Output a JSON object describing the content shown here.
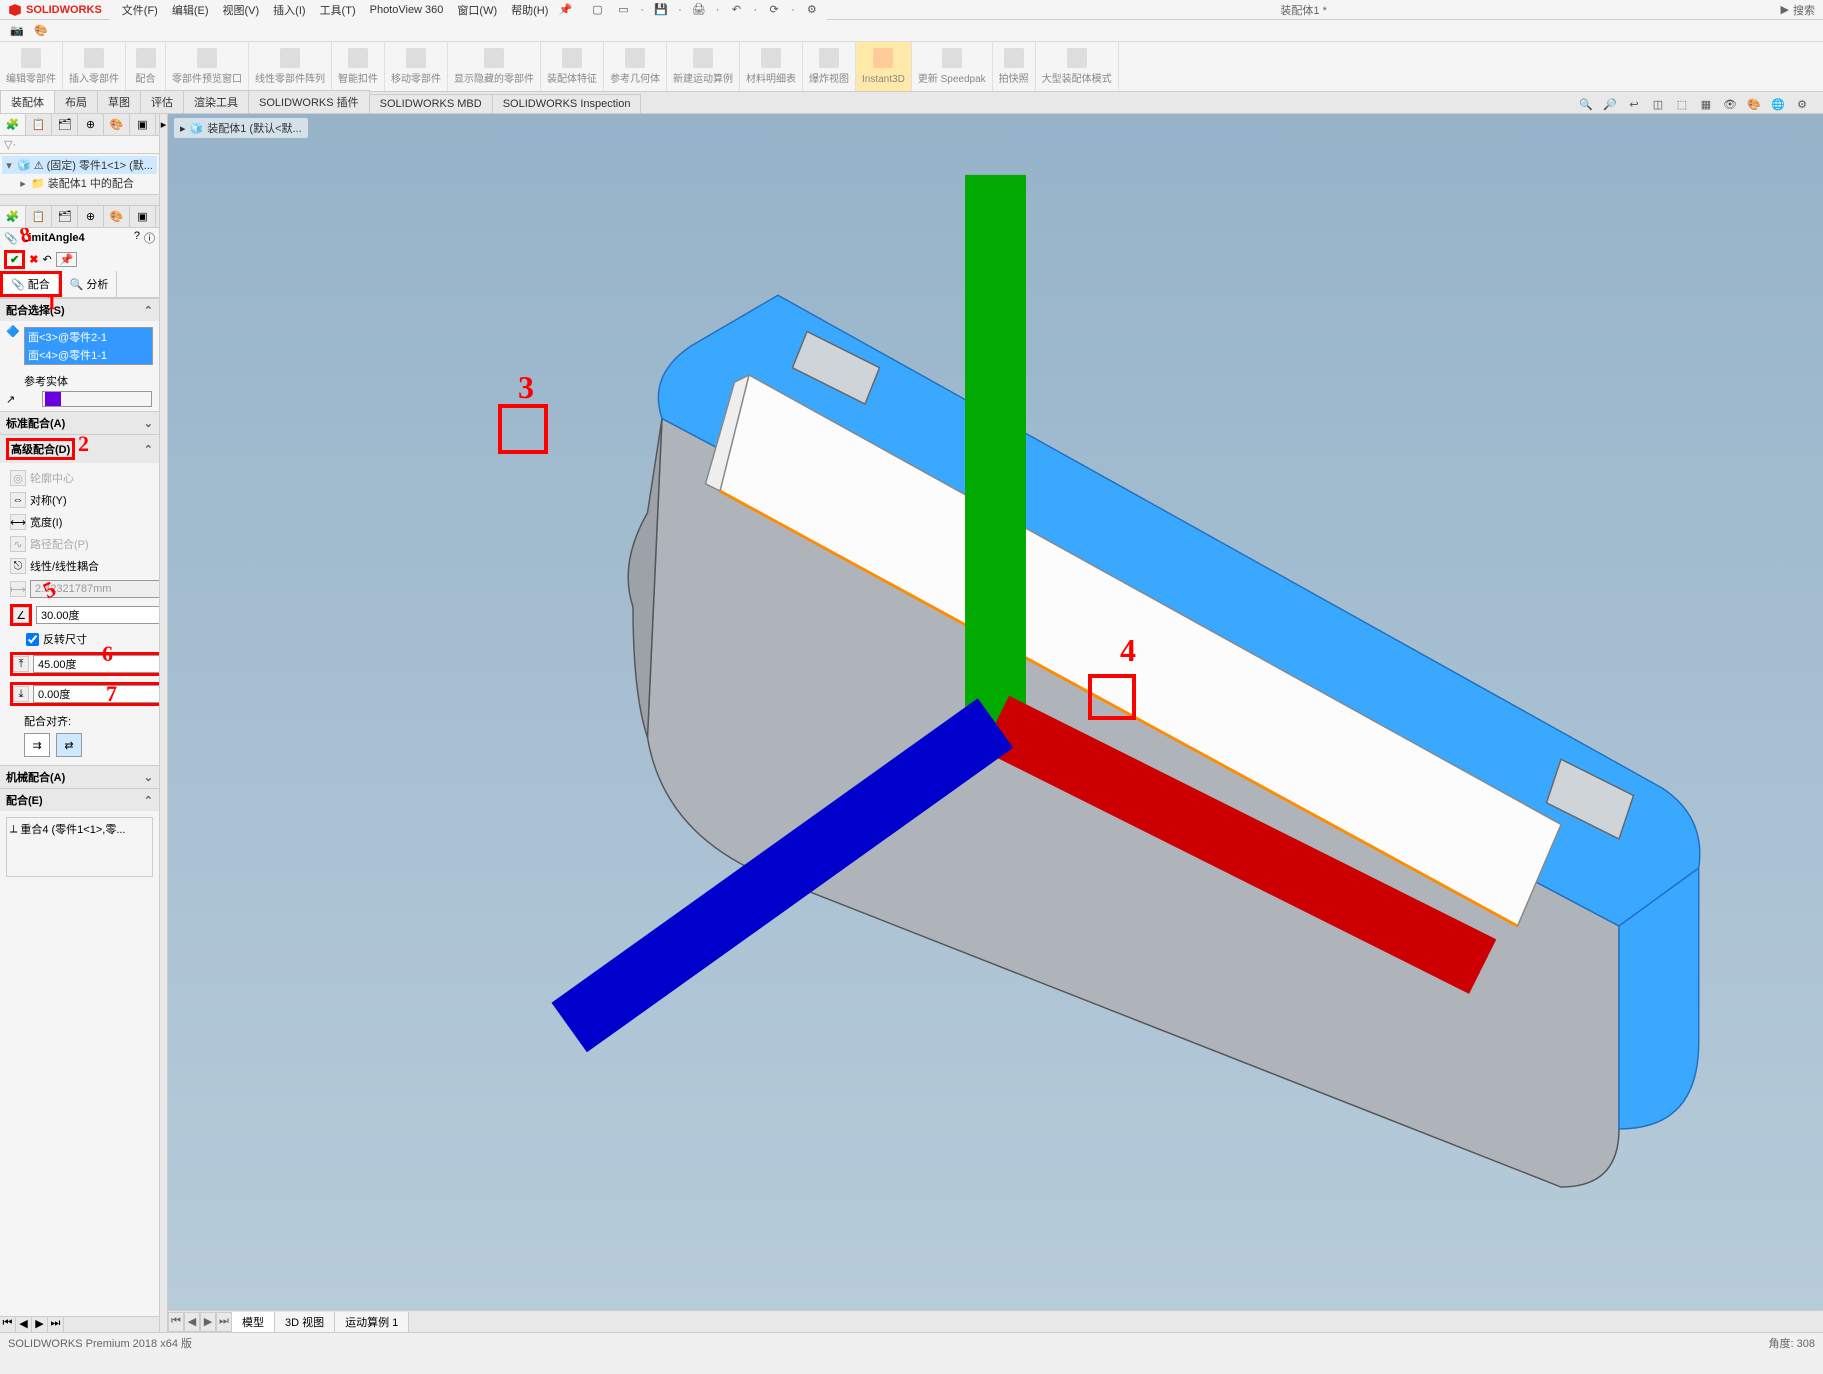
{
  "app": {
    "logo_text": "SOLIDWORKS",
    "doc_title": "装配体1 *",
    "search_placeholder": "搜索"
  },
  "menu": {
    "items": [
      "文件(F)",
      "编辑(E)",
      "视图(V)",
      "插入(I)",
      "工具(T)",
      "PhotoView 360",
      "窗口(W)",
      "帮助(H)"
    ]
  },
  "ribbon": {
    "groups": [
      {
        "label": "编辑零部件"
      },
      {
        "label": "插入零部件"
      },
      {
        "label": "配合"
      },
      {
        "label": "零部件预览窗口"
      },
      {
        "label": "线性零部件阵列"
      },
      {
        "label": "智能扣件"
      },
      {
        "label": "移动零部件"
      },
      {
        "label": "显示隐藏的零部件"
      },
      {
        "label": "装配体特征"
      },
      {
        "label": "参考几何体"
      },
      {
        "label": "新建运动算例"
      },
      {
        "label": "材料明细表"
      },
      {
        "label": "爆炸视图"
      },
      {
        "label": "Instant3D",
        "active": true
      },
      {
        "label": "更新 Speedpak"
      },
      {
        "label": "拍快照"
      },
      {
        "label": "大型装配体模式"
      }
    ]
  },
  "tabs": {
    "items": [
      "装配体",
      "布局",
      "草图",
      "评估",
      "渲染工具",
      "SOLIDWORKS 插件",
      "SOLIDWORKS MBD",
      "SOLIDWORKS Inspection"
    ],
    "active": 0
  },
  "fm_tree": {
    "filter_icon": "▽",
    "node1": "(固定) 零件1<1> (默...",
    "node2": "装配体1 中的配合"
  },
  "pm": {
    "title": "LimitAngle4",
    "tab_mate": "配合",
    "tab_analysis": "分析",
    "sec_selection": "配合选择(S)",
    "sel1": "面<3>@零件2-1",
    "sel2": "面<4>@零件1-1",
    "ref_entity": "参考实体",
    "sec_standard": "标准配合(A)",
    "sec_advanced": "高级配合(D)",
    "row_profile": "轮廓中心",
    "row_sym": "对称(Y)",
    "row_width": "宽度(I)",
    "row_path": "路径配合(P)",
    "row_linear": "线性/线性耦合",
    "val_dist_disabled": "2.32321787mm",
    "val_angle": "30.00度",
    "chk_flip": "反转尺寸",
    "val_max": "45.00度",
    "val_min": "0.00度",
    "lbl_align": "配合对齐:",
    "sec_mech": "机械配合(A)",
    "sec_mates": "配合(E)",
    "mate_item": "重合4 (零件1<1>,零..."
  },
  "breadcrumb3d": "装配体1  (默认<默...",
  "bottom_tabs": {
    "items": [
      "模型",
      "3D 视图",
      "运动算例 1"
    ],
    "active": 0
  },
  "status": {
    "left": "SOLIDWORKS Premium 2018 x64 版",
    "right": "角度: 308"
  },
  "annotations": {
    "n1": "1",
    "n2": "2",
    "n3": "3",
    "n4": "4",
    "n5": "5",
    "n6": "6",
    "n7": "7",
    "n8": "8"
  }
}
